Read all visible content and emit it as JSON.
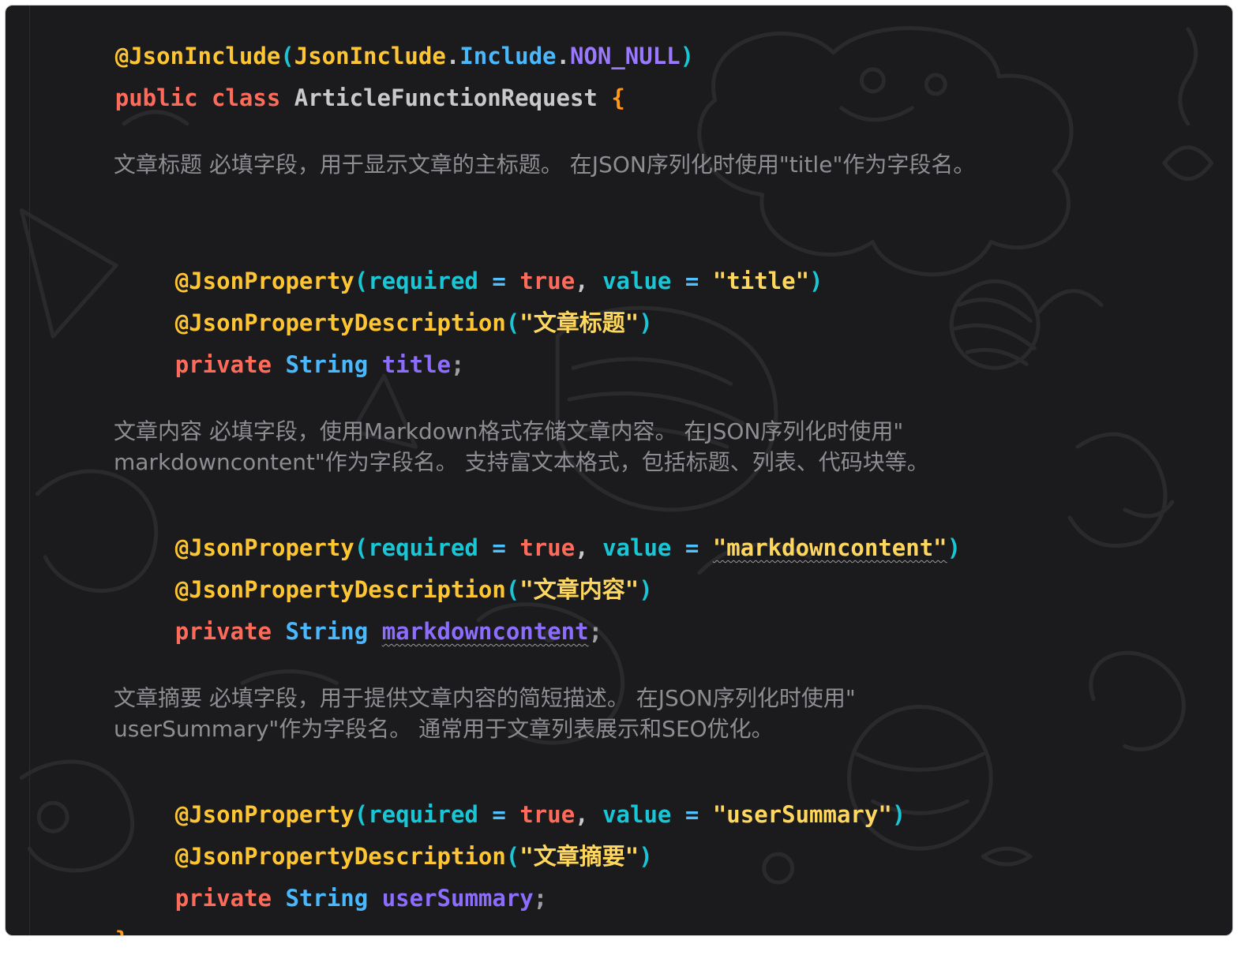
{
  "class_annotation": {
    "name": "@JsonInclude",
    "open": "(",
    "arg_class": "JsonInclude",
    "dot1": ".",
    "arg_member": "Include",
    "dot2": ".",
    "arg_value": "NON_NULL",
    "close": ")"
  },
  "class_decl": {
    "modifier": "public",
    "keyword": "class",
    "name": "ArticleFunctionRequest",
    "open_brace": "{",
    "close_brace": "}"
  },
  "fields": [
    {
      "doc": "文章标题 必填字段，用于显示文章的主标题。 在JSON序列化时使用\"title\"作为字段名。",
      "prop_annotation": "@JsonProperty",
      "required_key": "required",
      "eq": "=",
      "required_value": "true",
      "comma": ",",
      "value_key": "value",
      "value_string": "\"title\"",
      "desc_annotation": "@JsonPropertyDescription",
      "desc_string": "\"文章标题\"",
      "modifier": "private",
      "type": "String",
      "name": "title",
      "semicolon": ";",
      "open": "(",
      "close": ")"
    },
    {
      "doc": "文章内容 必填字段，使用Markdown格式存储文章内容。 在JSON序列化时使用\" markdowncontent\"作为字段名。 支持富文本格式，包括标题、列表、代码块等。",
      "prop_annotation": "@JsonProperty",
      "required_key": "required",
      "eq": "=",
      "required_value": "true",
      "comma": ",",
      "value_key": "value",
      "value_string": "\"markdowncontent\"",
      "desc_annotation": "@JsonPropertyDescription",
      "desc_string": "\"文章内容\"",
      "modifier": "private",
      "type": "String",
      "name": "markdowncontent",
      "semicolon": ";",
      "open": "(",
      "close": ")"
    },
    {
      "doc": "文章摘要 必填字段，用于提供文章内容的简短描述。 在JSON序列化时使用\" userSummary\"作为字段名。 通常用于文章列表展示和SEO优化。",
      "prop_annotation": "@JsonProperty",
      "required_key": "required",
      "eq": "=",
      "required_value": "true",
      "comma": ",",
      "value_key": "value",
      "value_string": "\"userSummary\"",
      "desc_annotation": "@JsonPropertyDescription",
      "desc_string": "\"文章摘要\"",
      "modifier": "private",
      "type": "String",
      "name": "userSummary",
      "semicolon": ";",
      "open": "(",
      "close": ")"
    }
  ],
  "colors": {
    "background": "#1b1b1d",
    "annotation": "#ffc533",
    "keyword": "#ff6b5b",
    "string": "#ffd75e",
    "type": "#49b8ff",
    "field": "#8c6dff",
    "param": "#19c6d6",
    "brace": "#ff9a1a",
    "doc_comment": "#8e8e92"
  }
}
